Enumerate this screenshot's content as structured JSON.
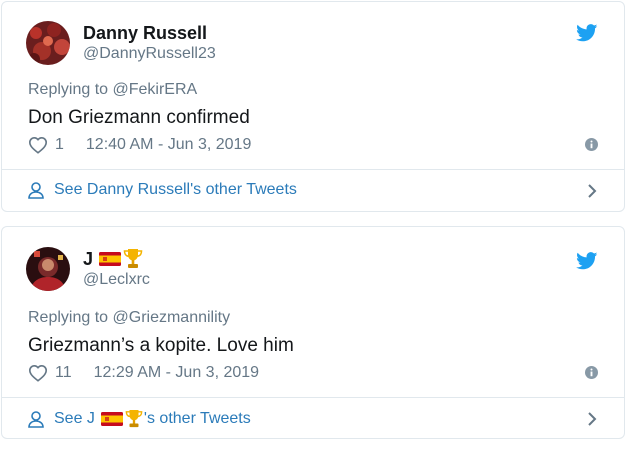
{
  "tweets": [
    {
      "display_name": "Danny Russell",
      "handle": "@DannyRussell23",
      "replying_prefix": "Replying to",
      "replying_to": "@FekirERA",
      "text": "Don Griezmann confirmed",
      "likes": "1",
      "timestamp": "12:40 AM - Jun 3, 2019",
      "footer_link": "See Danny Russell's other Tweets"
    },
    {
      "display_name": "J",
      "display_name_emojis": [
        "spain-flag",
        "trophy"
      ],
      "handle": "@Leclxrc",
      "replying_prefix": "Replying to",
      "replying_to": "@Griezmannility",
      "text": "Griezmann’s a kopite. Love him",
      "likes": "11",
      "timestamp": "12:29 AM - Jun 3, 2019",
      "footer_prefix": "See J",
      "footer_suffix": "'s other Tweets"
    }
  ],
  "colors": {
    "twitter_blue": "#1da1f2",
    "link_blue": "#2b7bb9",
    "text_dark": "#14171a",
    "text_gray": "#657786",
    "border": "#e1e8ed"
  },
  "icons": [
    "twitter-bird-icon",
    "heart-icon",
    "info-icon",
    "person-icon",
    "chevron-right-icon"
  ]
}
